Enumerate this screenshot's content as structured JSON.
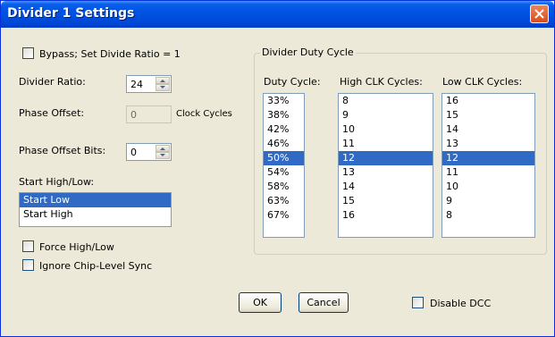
{
  "window": {
    "title": "Divider 1 Settings"
  },
  "bypass": {
    "label": "Bypass; Set Divide Ratio = 1",
    "checked": false
  },
  "divider_ratio": {
    "label": "Divider Ratio:",
    "value": "24"
  },
  "phase_offset": {
    "label": "Phase Offset:",
    "value": "0",
    "unit": "Clock Cycles"
  },
  "phase_offset_bits": {
    "label": "Phase Offset Bits:",
    "value": "0"
  },
  "start": {
    "label": "Start High/Low:",
    "items": [
      "Start Low",
      "Start High"
    ],
    "selected_index": 0
  },
  "force_high_low": {
    "label": "Force High/Low",
    "checked": false
  },
  "ignore_sync": {
    "label": "Ignore Chip-Level Sync",
    "checked": false
  },
  "duty_group": {
    "title": "Divider Duty Cycle",
    "headers": {
      "duty": "Duty Cycle:",
      "high": "High CLK Cycles:",
      "low": "Low CLK Cycles:"
    },
    "duty": [
      "33%",
      "38%",
      "42%",
      "46%",
      "50%",
      "54%",
      "58%",
      "63%",
      "67%"
    ],
    "high": [
      "8",
      "9",
      "10",
      "11",
      "12",
      "13",
      "14",
      "15",
      "16"
    ],
    "low": [
      "16",
      "15",
      "14",
      "13",
      "12",
      "11",
      "10",
      "9",
      "8"
    ],
    "selected_index": 4
  },
  "buttons": {
    "ok": "OK",
    "cancel": "Cancel"
  },
  "disable_dcc": {
    "label": "Disable DCC",
    "checked": false
  },
  "colors": {
    "selection": "#316ac5",
    "title_bar": "#0054e3",
    "dialog_bg": "#ece9d8"
  }
}
